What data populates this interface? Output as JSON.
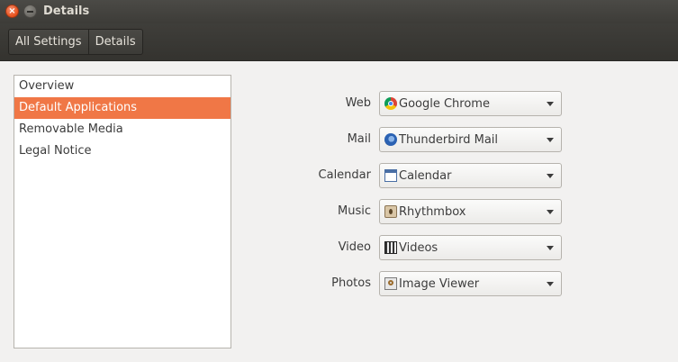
{
  "window": {
    "title": "Details"
  },
  "breadcrumb": [
    "All Settings",
    "Details"
  ],
  "sidebar": {
    "items": [
      {
        "label": "Overview"
      },
      {
        "label": "Default Applications"
      },
      {
        "label": "Removable Media"
      },
      {
        "label": "Legal Notice"
      }
    ],
    "selected": "Default Applications"
  },
  "defaults": [
    {
      "label": "Web",
      "value": "Google Chrome",
      "icon": "chrome-icon"
    },
    {
      "label": "Mail",
      "value": "Thunderbird Mail",
      "icon": "thunderbird-icon"
    },
    {
      "label": "Calendar",
      "value": "Calendar",
      "icon": "calendar-icon"
    },
    {
      "label": "Music",
      "value": "Rhythmbox",
      "icon": "rhythmbox-icon"
    },
    {
      "label": "Video",
      "value": "Videos",
      "icon": "videos-icon"
    },
    {
      "label": "Photos",
      "value": "Image Viewer",
      "icon": "image-viewer-icon"
    }
  ],
  "colors": {
    "accent": "#f07746",
    "titlebar": "#3c3b37"
  }
}
